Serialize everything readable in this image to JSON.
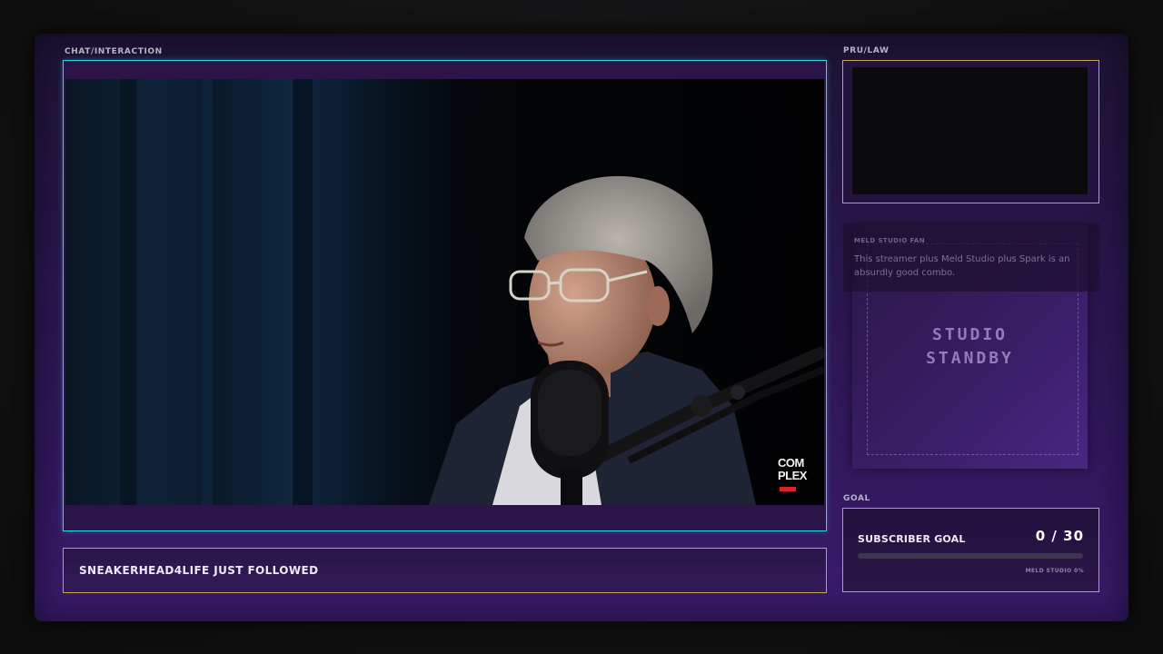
{
  "sections": {
    "chat_label": "CHAT/INTERACTION",
    "pru_label": "PRU/LAW",
    "goal_label": "GOAL"
  },
  "video": {
    "logo_text_line1": "COM",
    "logo_text_line2": "PLEX"
  },
  "alert": {
    "text": "SNEAKERHEAD4LIFE JUST FOLLOWED"
  },
  "chat": {
    "username": "MELD STUDIO FAN",
    "message": "This streamer plus Meld Studio plus Spark is an absurdly good combo."
  },
  "standby": {
    "line1": "STUDIO",
    "line2": "STANDBY"
  },
  "goal": {
    "title": "SUBSCRIBER GOAL",
    "count": "0 / 30",
    "current": 0,
    "target": 30,
    "caption": "MELD STUDIO 0%"
  },
  "colors": {
    "video_border": "#2fd6e6",
    "panel_border": "#c9a44e",
    "frame_purple": "#3a1b6b"
  }
}
